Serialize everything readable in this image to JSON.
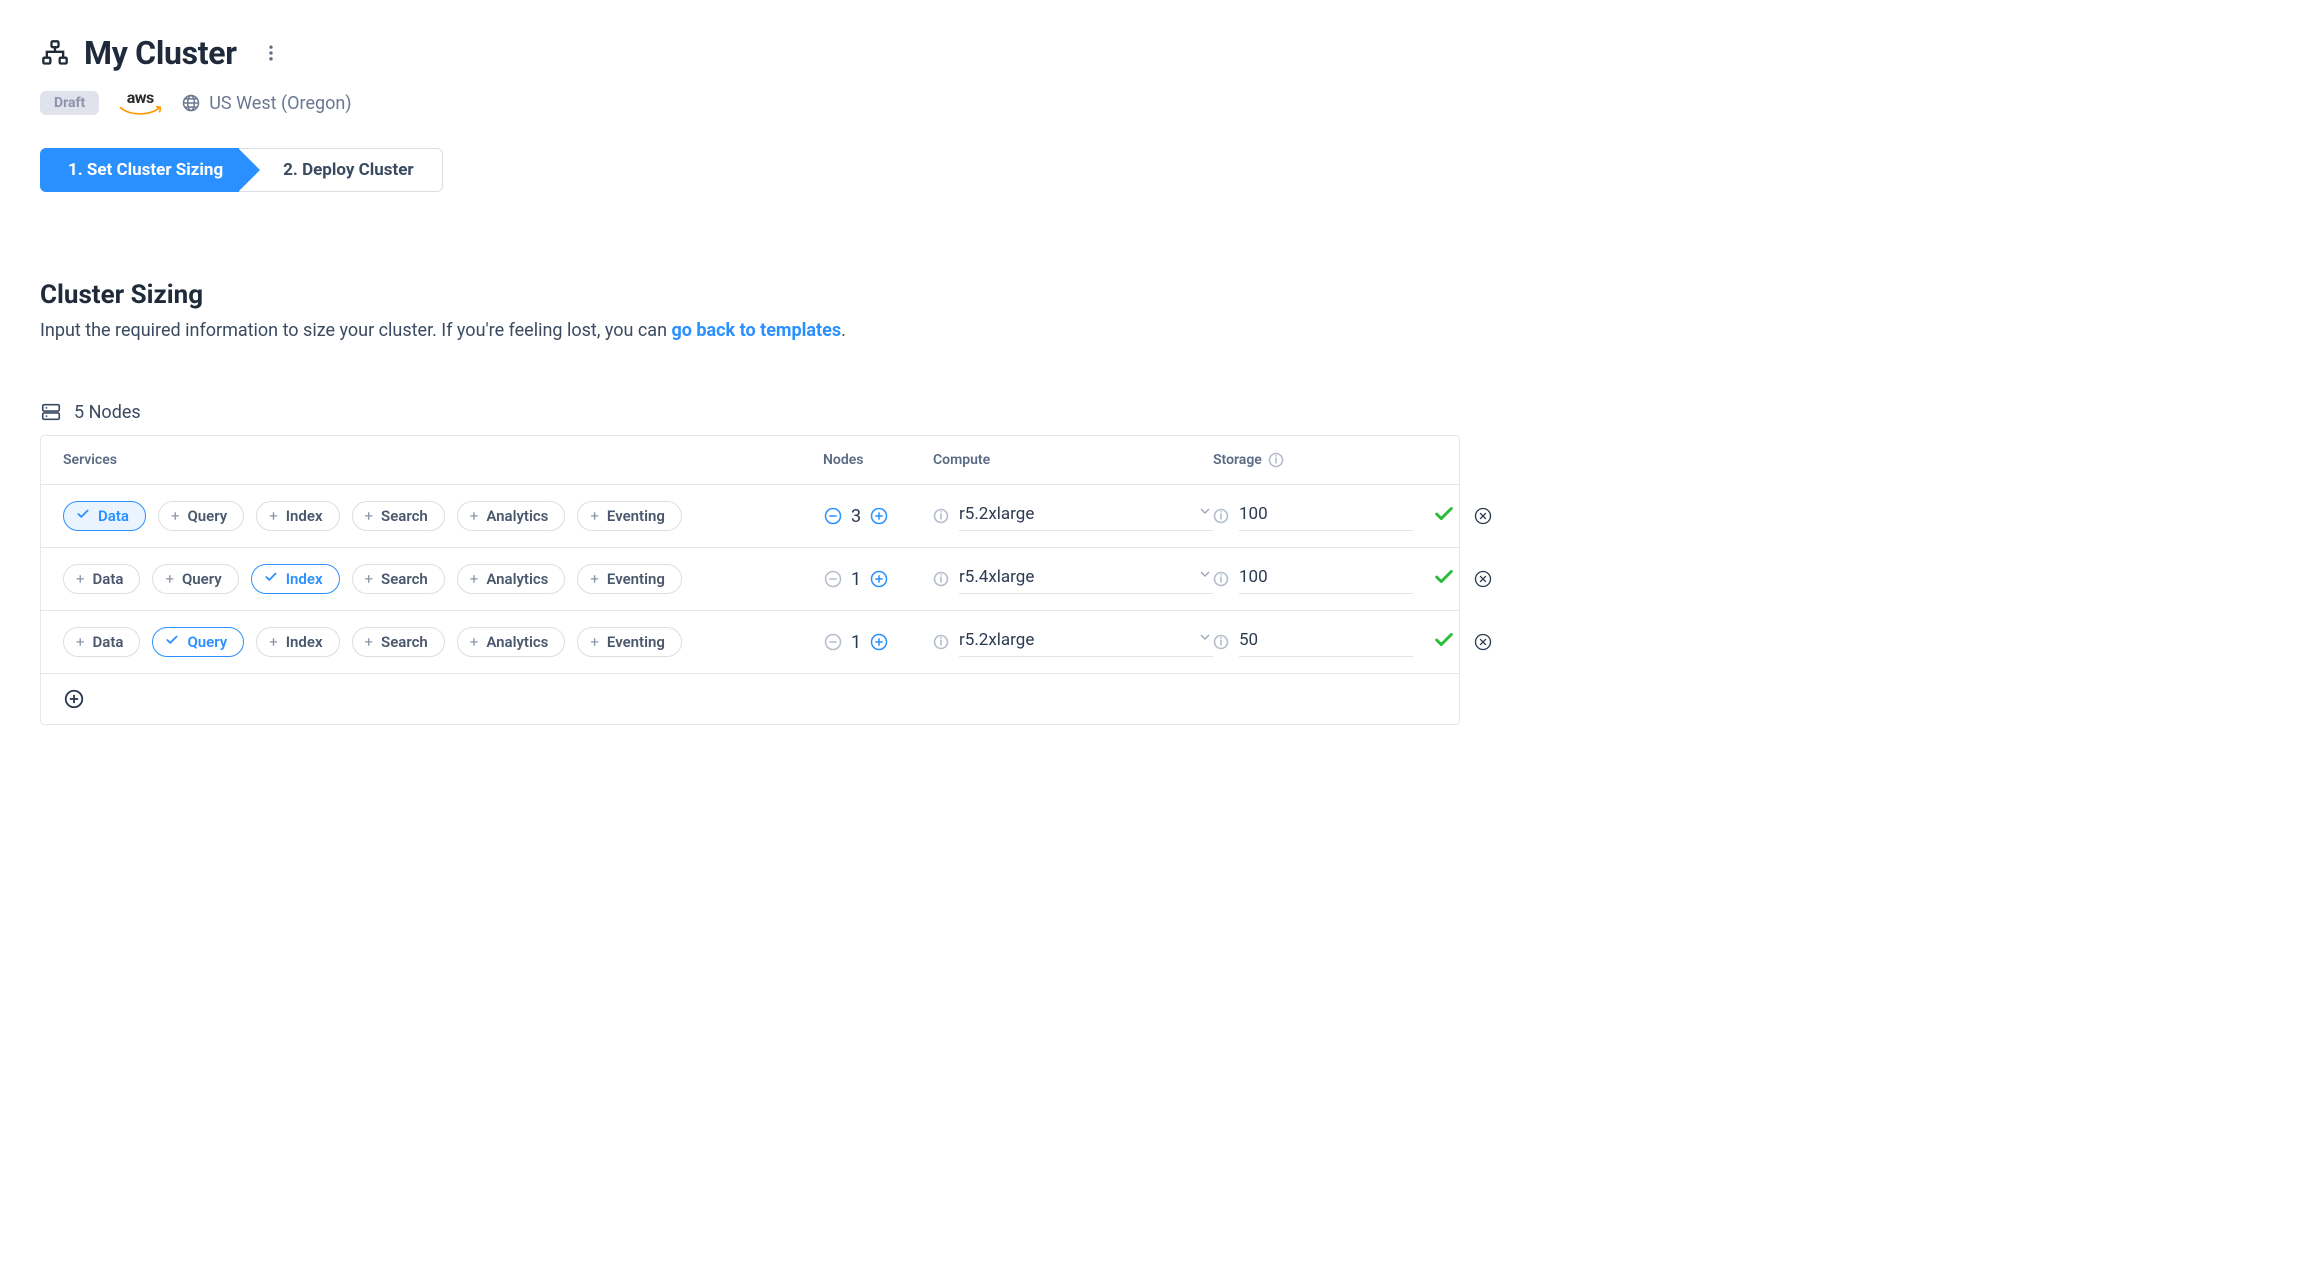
{
  "header": {
    "title": "My Cluster",
    "status_badge": "Draft",
    "provider": "aws",
    "region": "US West (Oregon)"
  },
  "stepper": {
    "steps": [
      {
        "label": "1. Set Cluster Sizing"
      },
      {
        "label": "2. Deploy Cluster"
      }
    ]
  },
  "section": {
    "title": "Cluster Sizing",
    "subtitle_prefix": "Input the required information to size your cluster. If you're feeling lost, you can ",
    "subtitle_link": "go back to templates",
    "subtitle_suffix": "."
  },
  "summary": {
    "nodes_label": "5 Nodes"
  },
  "table": {
    "headers": {
      "services": "Services",
      "nodes": "Nodes",
      "compute": "Compute",
      "storage": "Storage"
    }
  },
  "service_labels": {
    "data": "Data",
    "query": "Query",
    "index": "Index",
    "search": "Search",
    "analytics": "Analytics",
    "eventing": "Eventing"
  },
  "rows": [
    {
      "selected": "data",
      "selected_style": "filled",
      "nodes": "3",
      "minus_disabled": false,
      "compute": "r5.2xlarge",
      "storage": "100"
    },
    {
      "selected": "index",
      "selected_style": "outline",
      "nodes": "1",
      "minus_disabled": true,
      "compute": "r5.4xlarge",
      "storage": "100"
    },
    {
      "selected": "query",
      "selected_style": "outline",
      "nodes": "1",
      "minus_disabled": true,
      "compute": "r5.2xlarge",
      "storage": "50"
    }
  ]
}
